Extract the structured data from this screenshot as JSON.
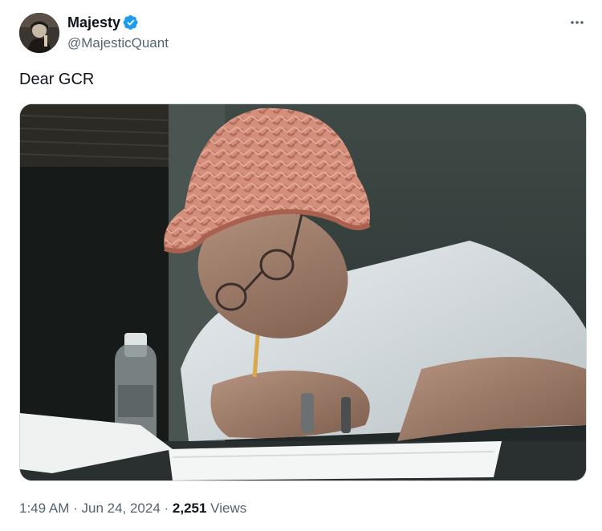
{
  "user": {
    "display_name": "Majesty",
    "handle": "@MajesticQuant",
    "verified": true,
    "verified_color": "#1d9bf0"
  },
  "tweet": {
    "text": "Dear GCR"
  },
  "meta": {
    "time": "1:49 AM",
    "separator1": " · ",
    "date": "Jun 24, 2024",
    "separator2": " · ",
    "views_count": "2,251",
    "views_label": " Views"
  },
  "icons": {
    "more": "more-options-icon",
    "verified": "verified-badge-icon"
  },
  "colors": {
    "text_primary": "#0f1419",
    "text_secondary": "#536471",
    "border": "#cfd9de"
  }
}
